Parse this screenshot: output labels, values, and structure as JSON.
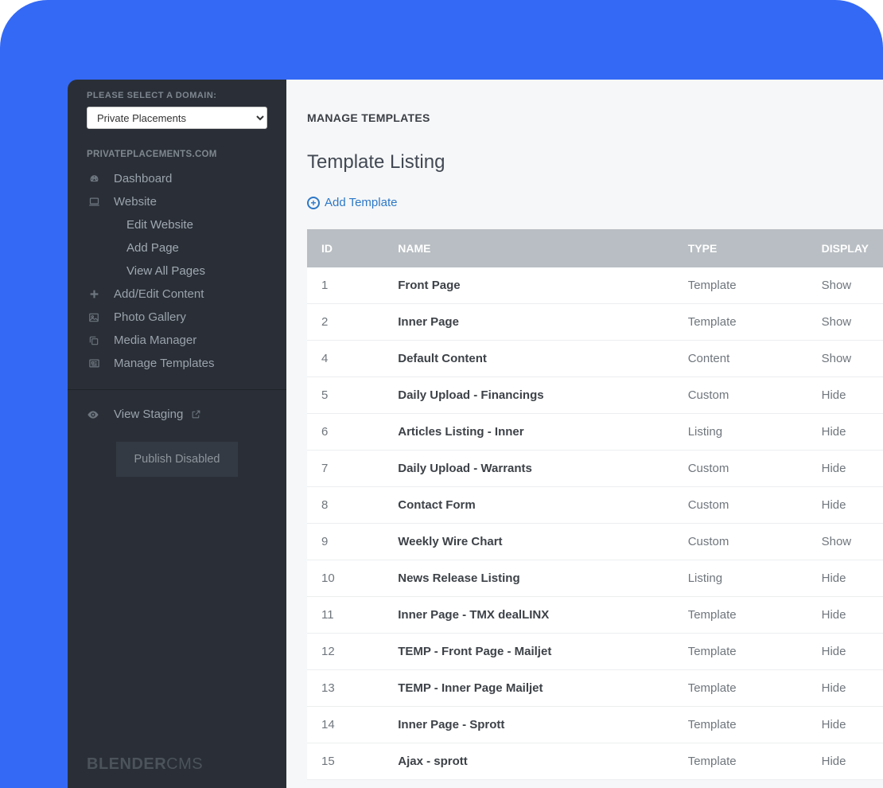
{
  "sidebar": {
    "select_label": "PLEASE SELECT A DOMAIN:",
    "select_value": "Private Placements",
    "domain_label": "PRIVATEPLACEMENTS.COM",
    "items": [
      {
        "icon": "dashboard-icon",
        "label": "Dashboard"
      },
      {
        "icon": "laptop-icon",
        "label": "Website"
      }
    ],
    "website_sub": [
      {
        "label": "Edit Website"
      },
      {
        "label": "Add Page"
      },
      {
        "label": "View All Pages"
      }
    ],
    "items2": [
      {
        "icon": "plus-icon",
        "label": "Add/Edit Content"
      },
      {
        "icon": "image-icon",
        "label": "Photo Gallery"
      },
      {
        "icon": "copy-icon",
        "label": "Media Manager"
      },
      {
        "icon": "newspaper-icon",
        "label": "Manage Templates"
      }
    ],
    "staging": {
      "label": "View Staging"
    },
    "publish": "Publish Disabled",
    "brand1": "BLENDER",
    "brand2": "CMS"
  },
  "main": {
    "crumb": "MANAGE TEMPLATES",
    "title": "Template Listing",
    "add_label": "Add Template",
    "headers": {
      "id": "ID",
      "name": "NAME",
      "type": "TYPE",
      "display": "DISPLAY"
    },
    "rows": [
      {
        "id": "1",
        "name": "Front Page",
        "type": "Template",
        "display": "Show"
      },
      {
        "id": "2",
        "name": "Inner Page",
        "type": "Template",
        "display": "Show"
      },
      {
        "id": "4",
        "name": "Default Content",
        "type": "Content",
        "display": "Show"
      },
      {
        "id": "5",
        "name": "Daily Upload - Financings",
        "type": "Custom",
        "display": "Hide"
      },
      {
        "id": "6",
        "name": "Articles Listing - Inner",
        "type": "Listing",
        "display": "Hide"
      },
      {
        "id": "7",
        "name": "Daily Upload - Warrants",
        "type": "Custom",
        "display": "Hide"
      },
      {
        "id": "8",
        "name": "Contact Form",
        "type": "Custom",
        "display": "Hide"
      },
      {
        "id": "9",
        "name": "Weekly Wire Chart",
        "type": "Custom",
        "display": "Show"
      },
      {
        "id": "10",
        "name": "News Release Listing",
        "type": "Listing",
        "display": "Hide"
      },
      {
        "id": "11",
        "name": "Inner Page - TMX dealLINX",
        "type": "Template",
        "display": "Hide"
      },
      {
        "id": "12",
        "name": "TEMP - Front Page - Mailjet",
        "type": "Template",
        "display": "Hide"
      },
      {
        "id": "13",
        "name": "TEMP - Inner Page Mailjet",
        "type": "Template",
        "display": "Hide"
      },
      {
        "id": "14",
        "name": "Inner Page - Sprott",
        "type": "Template",
        "display": "Hide"
      },
      {
        "id": "15",
        "name": "Ajax - sprott",
        "type": "Template",
        "display": "Hide"
      }
    ]
  }
}
